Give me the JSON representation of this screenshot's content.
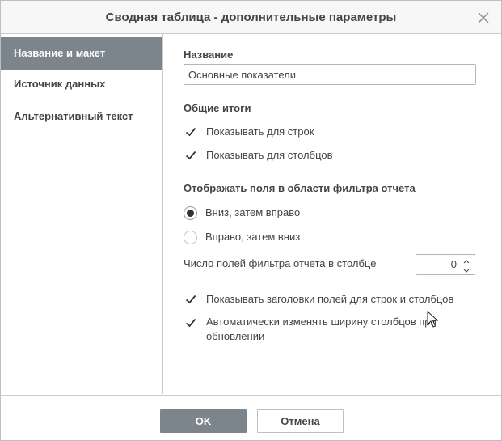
{
  "dialog": {
    "title": "Сводная таблица - дополнительные параметры",
    "icons": {
      "close": "close-icon",
      "checkbox": "checkmark-icon",
      "spin_up": "chevron-up-icon",
      "spin_down": "chevron-down-icon",
      "cursor": "mouse-pointer-icon"
    },
    "colors": {
      "accent": "#7d858c",
      "text": "#444444",
      "border": "#cbcbcb"
    }
  },
  "sidebar": {
    "items": [
      {
        "label": "Название и макет",
        "active": true
      },
      {
        "label": "Источник данных",
        "active": false
      },
      {
        "label": "Альтернативный текст",
        "active": false
      }
    ]
  },
  "main": {
    "name_section": {
      "label": "Название",
      "value": "Основные показатели"
    },
    "totals_section": {
      "label": "Общие итоги",
      "options": [
        {
          "label": "Показывать для строк",
          "checked": true
        },
        {
          "label": "Показывать для столбцов",
          "checked": true
        }
      ]
    },
    "filter_section": {
      "label": "Отображать поля в области фильтра отчета",
      "radios": [
        {
          "label": "Вниз, затем вправо",
          "selected": true
        },
        {
          "label": "Вправо, затем вниз",
          "selected": false
        }
      ],
      "fields_per_column_label": "Число полей фильтра отчета в столбце",
      "fields_per_column_value": "0"
    },
    "options": [
      {
        "label": "Показывать заголовки полей для строк и столбцов",
        "checked": true
      },
      {
        "label": "Автоматически изменять ширину столбцов при обновлении",
        "checked": true
      }
    ]
  },
  "footer": {
    "ok_label": "OK",
    "cancel_label": "Отмена"
  }
}
